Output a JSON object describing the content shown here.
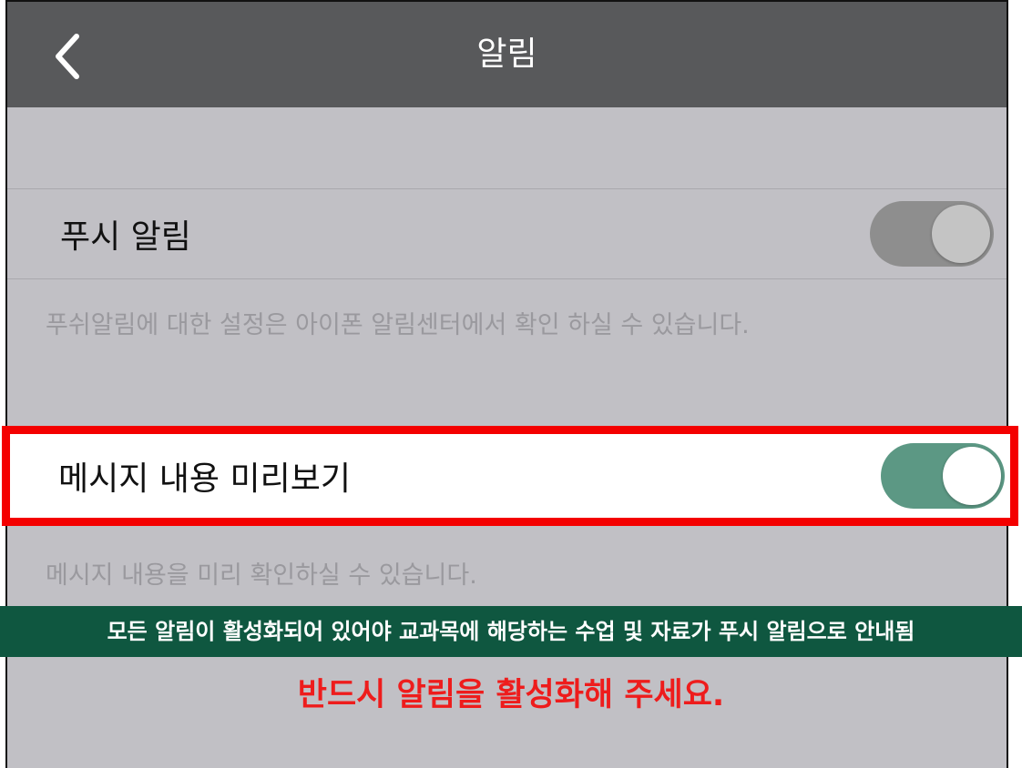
{
  "navbar": {
    "title": "알림",
    "back_icon": "chevron-left-icon"
  },
  "push": {
    "label": "푸시 알림",
    "toggle_on": true,
    "toggle_color": "#8e8e8e",
    "note": "푸쉬알림에 대한 설정은 아이폰 알림센터에서 확인 하실 수 있습니다."
  },
  "preview": {
    "label": "메시지 내용 미리보기",
    "toggle_on": true,
    "toggle_color": "#5c9884",
    "note": "메시지 내용을 미리 확인하실 수 있습니다."
  },
  "banner": {
    "text": "모든 알림이 활성화되어 있어야 교과목에 해당하는 수업 및 자료가 푸시 알림으로 안내됨"
  },
  "warning": {
    "text": "반드시 알림을 활성화해 주세요."
  },
  "colors": {
    "navbar_bg": "#58595b",
    "page_bg": "#c1c0c5",
    "highlight_border": "#f40000",
    "banner_bg": "#0f5740",
    "warning_text": "#ee1c1c"
  }
}
